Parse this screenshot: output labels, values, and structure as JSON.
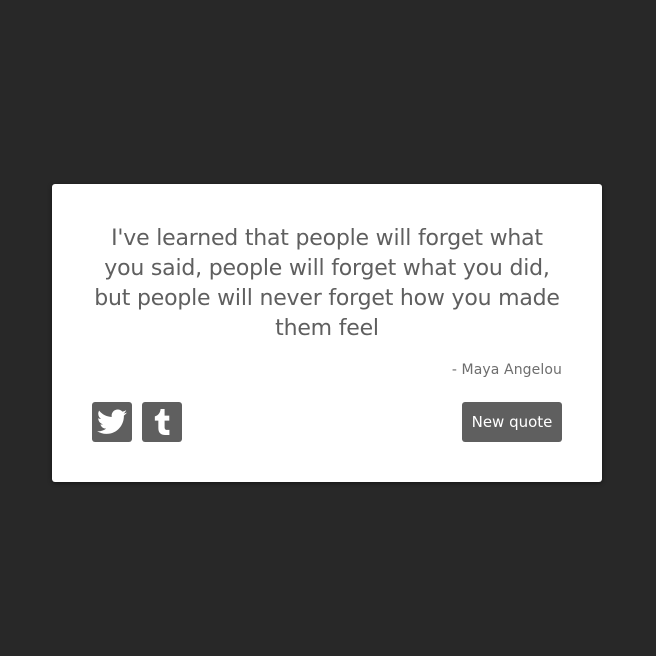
{
  "quote": {
    "text": "I've learned that people will forget what you said, people will forget what you did, but people will never forget how you made them feel",
    "author": "- Maya Angelou"
  },
  "actions": {
    "twitter_icon": "twitter-icon",
    "tumblr_icon": "tumblr-icon",
    "new_quote_label": "New quote"
  },
  "colors": {
    "background": "#282828",
    "card": "#ffffff",
    "text": "#5f5f5f",
    "button": "#5f5f5f",
    "button_text": "#ffffff"
  }
}
